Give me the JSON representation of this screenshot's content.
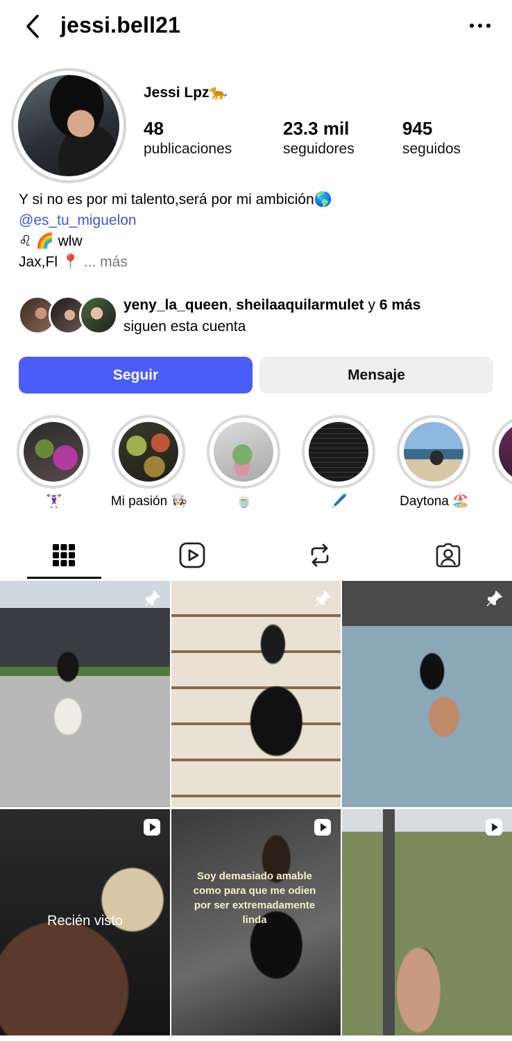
{
  "header": {
    "username": "jessi.bell21"
  },
  "profile": {
    "display_name": "Jessi Lpz🐆",
    "stats": [
      {
        "value": "48",
        "label": "publicaciones"
      },
      {
        "value": "23.3 mil",
        "label": "seguidores"
      },
      {
        "value": "945",
        "label": "seguidos"
      }
    ],
    "bio": {
      "line1": "Y si no es por mi talento,será por mi ambición🌎",
      "link": "@es_tu_miguelon",
      "line3": "♌ 🌈  wlw",
      "line4": "Jax,Fl 📍",
      "more": "... más"
    }
  },
  "followed_by": {
    "user1": "yeny_la_queen",
    "sep": ", ",
    "user2": "sheilaaquilarmulet",
    "and": " y ",
    "more": "6 más",
    "suffix": "siguen esta cuenta"
  },
  "actions": {
    "follow": "Seguir",
    "message": "Mensaje"
  },
  "highlights": [
    {
      "label": "🏋🏻‍♀️"
    },
    {
      "label": "Mi pasión 👩🏻‍🍳"
    },
    {
      "label": "🍵"
    },
    {
      "label": "🖊️"
    },
    {
      "label": "Daytona 🏖️"
    }
  ],
  "grid": {
    "overlay_recent": "Recién visto",
    "overlay_quote": "Soy demasiado amable como para que me odien por ser extremadamente linda"
  },
  "icons": {
    "back": "chevron-left-icon",
    "more": "more-horizontal-icon",
    "pin": "pin-icon",
    "reel": "reel-icon",
    "grid": "grid-icon",
    "reels_tab": "reels-tab-icon",
    "reposts": "repost-icon",
    "tagged": "tagged-icon"
  },
  "colors": {
    "accent": "#4a5df9",
    "link": "#3a5bd0"
  }
}
